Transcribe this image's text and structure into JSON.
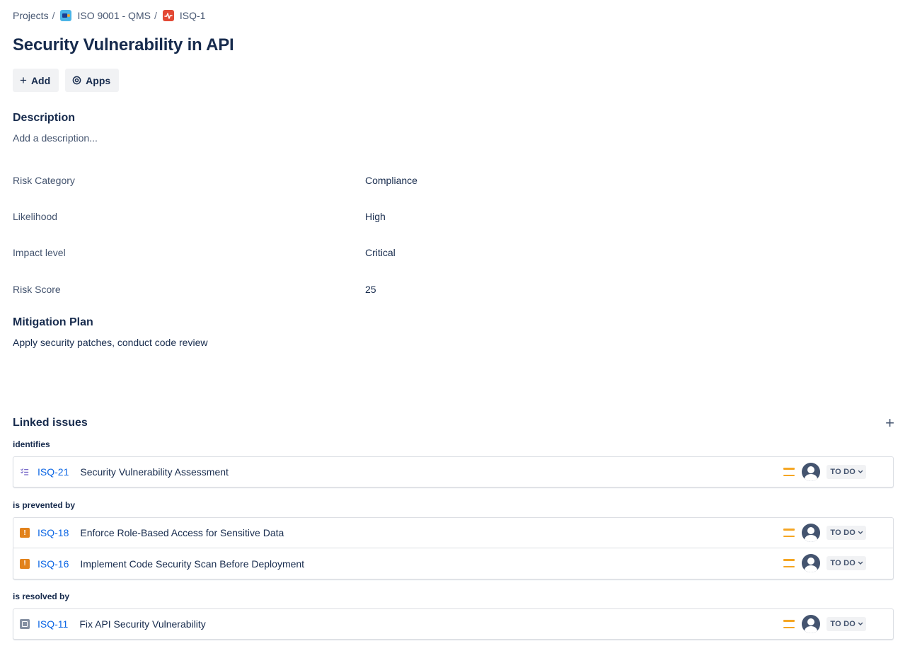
{
  "breadcrumb": {
    "projects": "Projects",
    "project": "ISO 9001 - QMS",
    "issue": "ISQ-1",
    "separator": "/"
  },
  "title": "Security Vulnerability in API",
  "actions": {
    "add": "Add",
    "apps": "Apps"
  },
  "description": {
    "heading": "Description",
    "placeholder": "Add a description..."
  },
  "fields": [
    {
      "label": "Risk Category",
      "value": "Compliance"
    },
    {
      "label": "Likelihood",
      "value": "High"
    },
    {
      "label": "Impact level",
      "value": "Critical"
    },
    {
      "label": "Risk Score",
      "value": "25"
    }
  ],
  "mitigation": {
    "heading": "Mitigation Plan",
    "text": "Apply security patches, conduct code review"
  },
  "linked": {
    "heading": "Linked issues",
    "add_icon": "plus-icon",
    "groups": [
      {
        "label": "identifies",
        "issues": [
          {
            "type": "subtask",
            "key": "ISQ-21",
            "summary": "Security Vulnerability Assessment",
            "priority": "medium",
            "status": "TO DO"
          }
        ]
      },
      {
        "label": "is prevented by",
        "issues": [
          {
            "type": "risk",
            "key": "ISQ-18",
            "summary": "Enforce Role-Based Access for Sensitive Data",
            "priority": "medium",
            "status": "TO DO"
          },
          {
            "type": "risk",
            "key": "ISQ-16",
            "summary": "Implement Code Security Scan Before Deployment",
            "priority": "medium",
            "status": "TO DO"
          }
        ]
      },
      {
        "label": "is resolved by",
        "issues": [
          {
            "type": "task",
            "key": "ISQ-11",
            "summary": "Fix API Security Vulnerability",
            "priority": "medium",
            "status": "TO DO"
          }
        ]
      }
    ]
  },
  "colors": {
    "link": "#0c66e4",
    "priority_medium": "#f5a623",
    "risk_icon": "#e2821b",
    "text": "#172b4d"
  }
}
